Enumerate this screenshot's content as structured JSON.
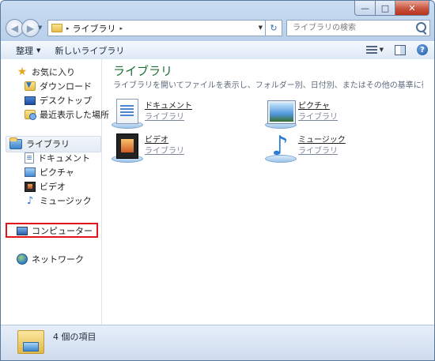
{
  "window": {
    "caption": {
      "minimize": "—",
      "maximize": "□",
      "close": "✕"
    }
  },
  "navigation": {
    "back_glyph": "◀",
    "forward_glyph": "▶",
    "breadcrumb": "ライブラリ",
    "breadcrumb_arrow": "▸",
    "refresh_glyph": "↻",
    "search_placeholder": "ライブラリの検索"
  },
  "toolbar": {
    "organize_label": "整理",
    "new_library_label": "新しいライブラリ",
    "help_label": "?"
  },
  "sidebar": {
    "favorites": "お気に入り",
    "favorite_items": [
      "ダウンロード",
      "デスクトップ",
      "最近表示した場所"
    ],
    "libraries": "ライブラリ",
    "library_items": [
      "ドキュメント",
      "ピクチャ",
      "ビデオ",
      "ミュージック"
    ],
    "computer": "コンピューター",
    "network": "ネットワーク"
  },
  "main": {
    "title": "ライブラリ",
    "description": "ライブラリを開いてファイルを表示し、フォルダー別、日付別、またはその他の基準に従...",
    "tiles": [
      {
        "name": "ドキュメント",
        "sub": "ライブラリ"
      },
      {
        "name": "ピクチャ",
        "sub": "ライブラリ"
      },
      {
        "name": "ビデオ",
        "sub": "ライブラリ"
      },
      {
        "name": "ミュージック",
        "sub": "ライブラリ"
      }
    ]
  },
  "status": {
    "item_count": "4 個の項目"
  },
  "icons": {
    "favorites": "star-icon",
    "downloads": "downloads-folder-icon",
    "desktop": "desktop-icon",
    "recent": "recent-places-icon",
    "libraries": "libraries-icon",
    "documents": "documents-icon",
    "pictures": "pictures-icon",
    "videos": "videos-icon",
    "music": "music-icon",
    "computer": "computer-icon",
    "network": "network-icon"
  },
  "colors": {
    "highlight_box": "#e0141a",
    "library_title": "#1f6e36"
  }
}
